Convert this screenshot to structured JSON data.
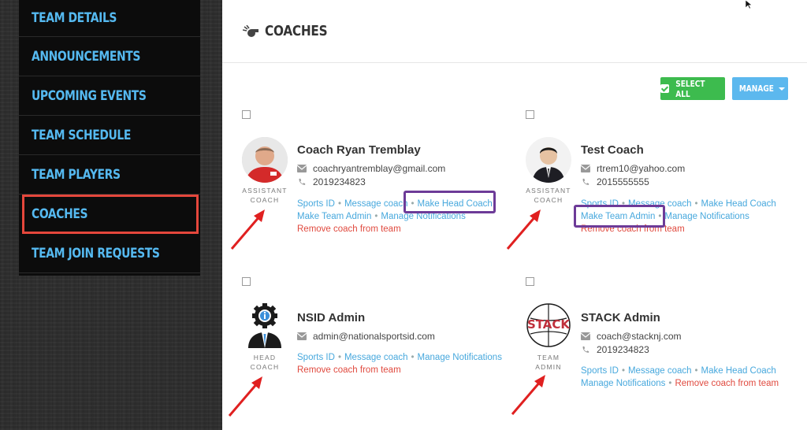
{
  "sidebar": {
    "items": [
      {
        "label": "TEAM DETAILS"
      },
      {
        "label": "ANNOUNCEMENTS"
      },
      {
        "label": "UPCOMING EVENTS"
      },
      {
        "label": "TEAM SCHEDULE"
      },
      {
        "label": "TEAM PLAYERS"
      },
      {
        "label": "COACHES"
      },
      {
        "label": "TEAM JOIN REQUESTS"
      }
    ],
    "active": "COACHES"
  },
  "header": {
    "title": "COACHES",
    "icon": "whistle-icon"
  },
  "toolbar": {
    "select_all": "SELECT ALL",
    "manage": "MANAGE"
  },
  "colors": {
    "accent_blue": "#47a8dd",
    "nav_blue": "#55b9f0",
    "danger": "#e04a3f",
    "green": "#3dbb4e",
    "highlight": "#6d3b98",
    "active_border": "#e5473c"
  },
  "coaches": [
    {
      "name": "Coach Ryan Tremblay",
      "email": "coachryantremblay@gmail.com",
      "phone": "2019234823",
      "role_line1": "ASSISTANT",
      "role_line2": "COACH",
      "links": {
        "sports_id": "Sports ID",
        "message": "Message coach",
        "make_head": "Make Head Coach",
        "make_admin": "Make Team Admin",
        "notifications": "Manage Notifications",
        "remove": "Remove coach from team"
      }
    },
    {
      "name": "Test Coach",
      "email": "rtrem10@yahoo.com",
      "phone": "2015555555",
      "role_line1": "ASSISTANT",
      "role_line2": "COACH",
      "links": {
        "sports_id": "Sports ID",
        "message": "Message coach",
        "make_head": "Make Head Coach",
        "make_admin": "Make Team Admin",
        "notifications": "Manage Notifications",
        "remove": "Remove coach from team"
      }
    },
    {
      "name": "NSID Admin",
      "email": "admin@nationalsportsid.com",
      "role_line1": "HEAD",
      "role_line2": "COACH",
      "links": {
        "sports_id": "Sports ID",
        "message": "Message coach",
        "notifications": "Manage Notifications",
        "remove": "Remove coach from team"
      }
    },
    {
      "name": "STACK Admin",
      "email": "coach@stacknj.com",
      "phone": "2019234823",
      "role_line1": "TEAM",
      "role_line2": "ADMIN",
      "logo_text": "STACK",
      "links": {
        "sports_id": "Sports ID",
        "message": "Message coach",
        "make_head": "Make Head Coach",
        "notifications": "Manage Notifications",
        "remove": "Remove coach from team"
      }
    }
  ]
}
